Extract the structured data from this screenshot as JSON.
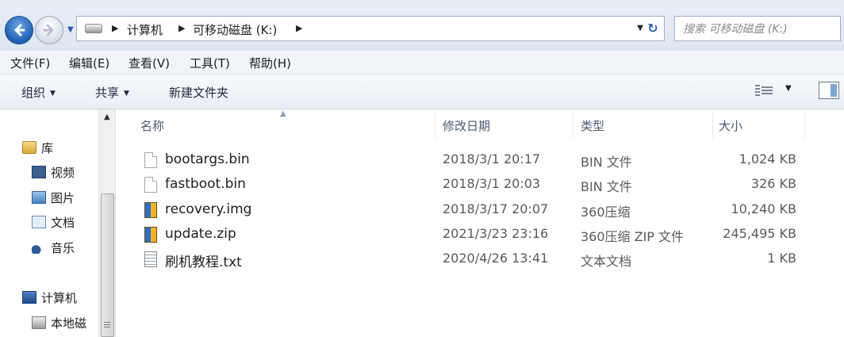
{
  "address_bar": {
    "breadcrumbs": [
      "计算机",
      "可移动磁盘 (K:)"
    ],
    "search_placeholder": "搜索 可移动磁盘 (K:)"
  },
  "menu": [
    "文件(F)",
    "编辑(E)",
    "查看(V)",
    "工具(T)",
    "帮助(H)"
  ],
  "command_bar": {
    "organize": "组织",
    "share": "共享",
    "new_folder": "新建文件夹"
  },
  "nav_pane": {
    "libraries": "库",
    "library_items": [
      "视频",
      "图片",
      "文档",
      "音乐"
    ],
    "computer": "计算机",
    "local_disk": "本地磁"
  },
  "columns": [
    "名称",
    "修改日期",
    "类型",
    "大小"
  ],
  "files": [
    {
      "icon": "file-icon",
      "name": "bootargs.bin",
      "date": "2018/3/1 20:17",
      "type": "BIN 文件",
      "size": "1,024 KB"
    },
    {
      "icon": "file-icon",
      "name": "fastboot.bin",
      "date": "2018/3/1 20:03",
      "type": "BIN 文件",
      "size": "326 KB"
    },
    {
      "icon": "archive-icon",
      "name": "recovery.img",
      "date": "2018/3/17 20:07",
      "type": "360压缩",
      "size": "10,240 KB"
    },
    {
      "icon": "archive-icon",
      "name": "update.zip",
      "date": "2021/3/23 23:16",
      "type": "360压缩 ZIP 文件",
      "size": "245,495 KB"
    },
    {
      "icon": "text-file-icon",
      "name": "刷机教程.txt",
      "date": "2020/4/26 13:41",
      "type": "文本文档",
      "size": "1 KB"
    }
  ]
}
